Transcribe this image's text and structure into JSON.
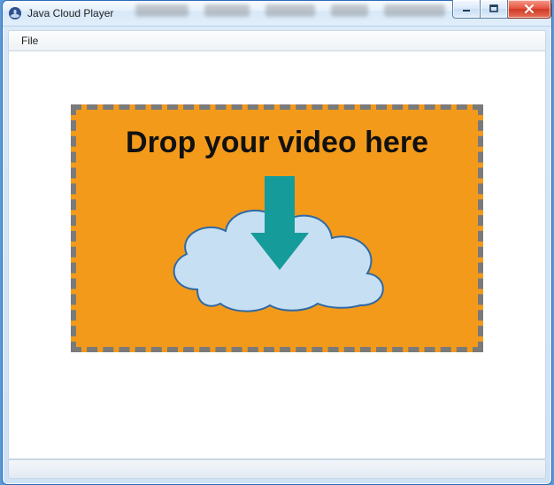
{
  "window": {
    "title": "Java Cloud Player"
  },
  "menubar": {
    "items": [
      {
        "label": "File"
      }
    ]
  },
  "dropzone": {
    "label": "Drop your video here"
  },
  "colors": {
    "dropzone_bg": "#f39a1b",
    "dropzone_border": "#7a7a7a",
    "arrow": "#169b9b",
    "cloud_fill": "#c7dff2",
    "cloud_stroke": "#2f6aa3"
  }
}
